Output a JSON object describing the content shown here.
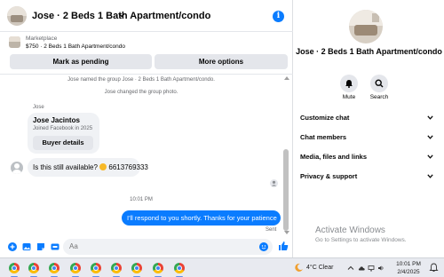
{
  "header": {
    "title": "Jose · 2 Beds 1 Bath Apartment/condo"
  },
  "marketplace": {
    "label": "Marketplace",
    "listing": "$750 · 2 Beds 1 Bath Apartment/condo",
    "pending_button": "Mark as pending",
    "options_button": "More options"
  },
  "messages": {
    "system_1": "Jose named the group Jose · 2 Beds 1 Bath Apartment/condo.",
    "system_2": "Jose changed the group photo.",
    "sender": "Jose",
    "card_name": "Jose Jacintos",
    "card_sub": "Joined Facebook in 2025",
    "card_button": "Buyer details",
    "incoming_text": "Is this still available?",
    "incoming_phone": "6613769333",
    "timestamp": "10:01 PM",
    "outgoing_text": "I'll respond to you shortly. Thanks for your patience",
    "status": "Sent"
  },
  "composer": {
    "placeholder": "Aa"
  },
  "info": {
    "title": "Jose · 2 Beds 1 Bath Apartment/condo",
    "mute_label": "Mute",
    "search_label": "Search",
    "sections": [
      "Customize chat",
      "Chat members",
      "Media, files and links",
      "Privacy & support"
    ]
  },
  "watermark": {
    "title": "Activate Windows",
    "subtitle": "Go to Settings to activate Windows."
  },
  "taskbar": {
    "weather": "4°C  Clear",
    "time": "10:01 PM",
    "date": "2/4/2025",
    "pinned_icons": [
      "chrome-icon",
      "chrome-icon",
      "chrome-icon",
      "chrome-icon",
      "chrome-icon",
      "chrome-icon",
      "chrome-icon",
      "chrome-icon",
      "chrome-icon"
    ]
  },
  "colors": {
    "accent": "#0a7cff",
    "bubble_in": "#f0f2f5",
    "button_gray": "#e4e6eb",
    "taskbar": "#e8eaf0"
  }
}
